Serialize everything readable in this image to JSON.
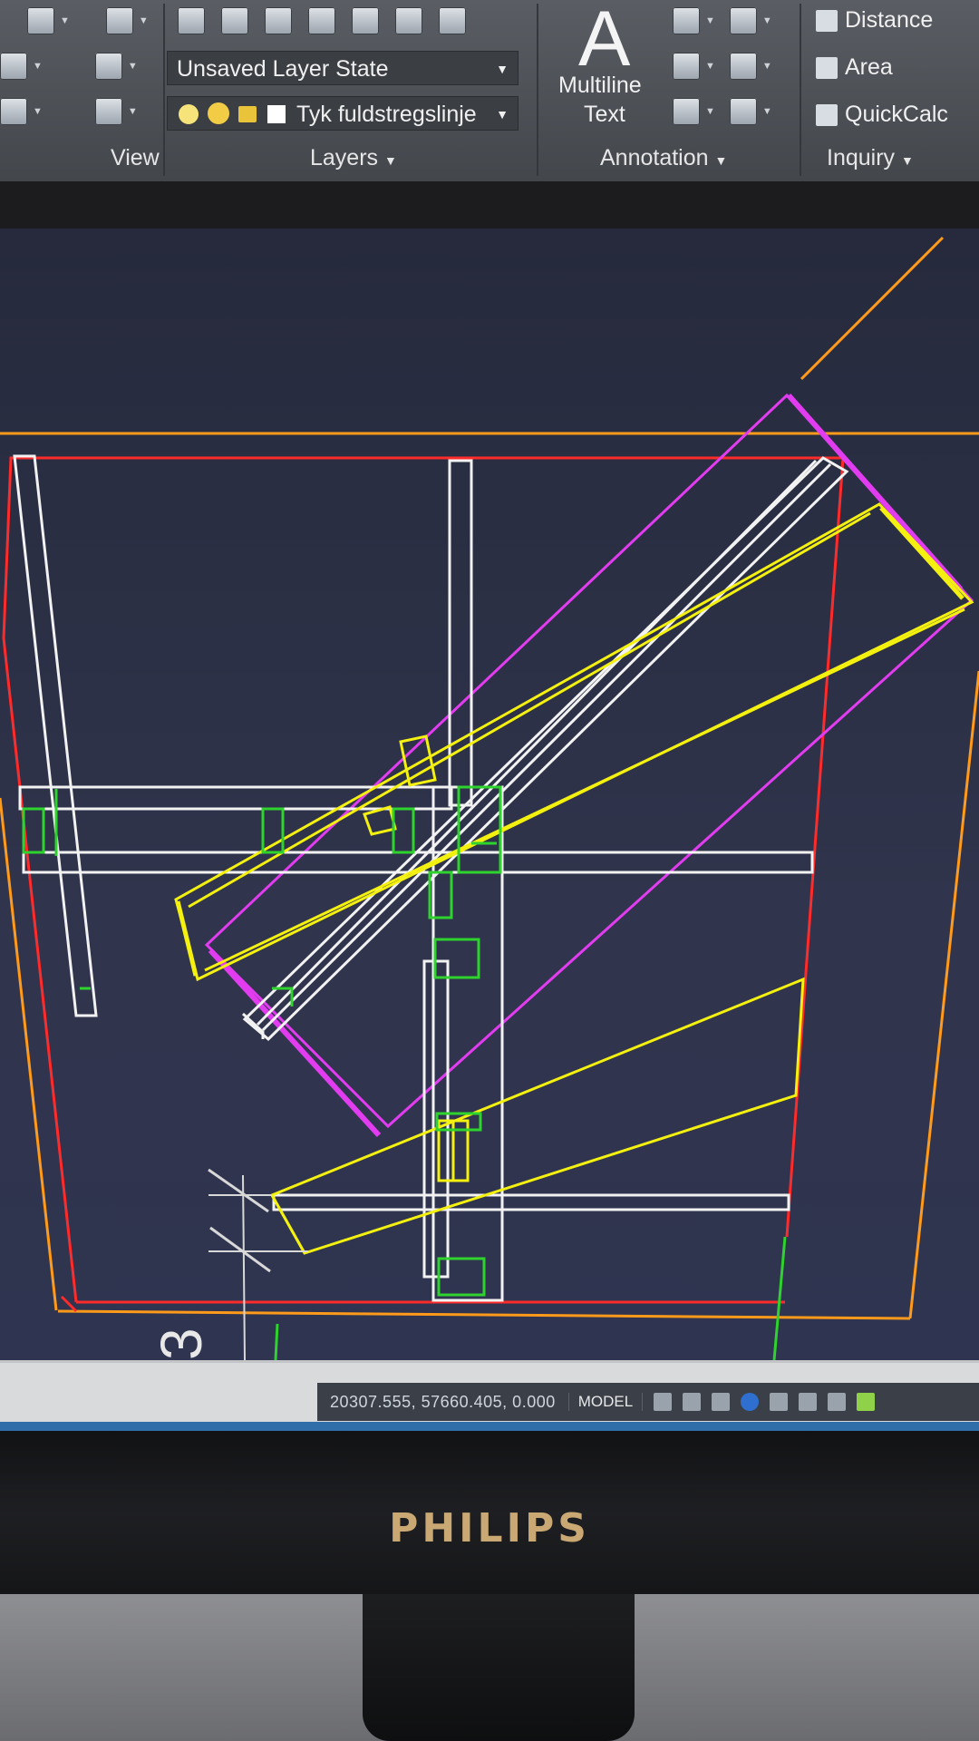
{
  "ribbon": {
    "layer_state": "Unsaved Layer State",
    "layer_name": "Tyk fuldstregslinje",
    "multiline_text_line1": "Multiline",
    "multiline_text_line2": "Text",
    "multiline_icon": "A",
    "inquiry_items": [
      "Distance",
      "Area",
      "QuickCalc"
    ],
    "panels": {
      "view": "View",
      "layers": "Layers",
      "annotation": "Annotation",
      "inquiry": "Inquiry"
    }
  },
  "status_bar": {
    "coordinates": "20307.555, 57660.405, 0.000",
    "model": "MODEL"
  },
  "monitor": {
    "brand": "PHILIPS"
  },
  "canvas": {
    "drawing_text": "3",
    "colors": {
      "background": "#2c3046",
      "red": "#ff2b2b",
      "orange": "#ff9a1a",
      "yellow": "#f4f00f",
      "white": "#f2f2f2",
      "green": "#2ed32e",
      "magenta": "#e23cf0"
    }
  }
}
